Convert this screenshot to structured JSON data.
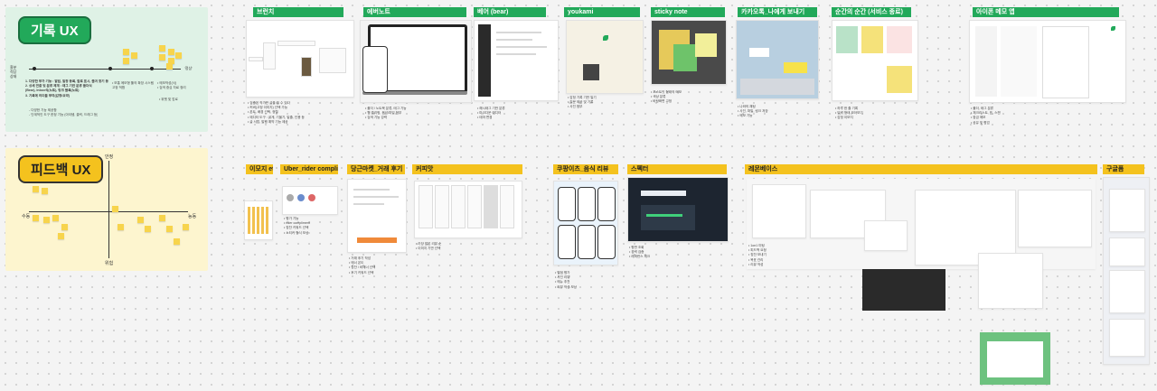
{
  "sections": {
    "record": {
      "title": "기록 UX",
      "bg": "#dff2e6"
    },
    "feedback": {
      "title": "피드백 UX",
      "bg": "#fdf5cf"
    }
  },
  "record_map": {
    "axis_left": "흥분\n적당\n상태",
    "axis_right": "'정상'",
    "points": [
      "1. 다양한 부가 기능 : 알림, 일정 등록, 할로 표시, 즐겨 찾기 등",
      "2. 상세 연결 및 분류 체계 : 태그 기반 분류 폴더식",
      "(Bear), Inbox식(노트), 링크 블록(노트)",
      "3. 기록에 의미를 부여(감정/요약)"
    ],
    "sub_notes": [
      "- 다양한 기능 제공함",
      "- 단계적인 도구 한정 기능 (아이템, 클릭, 드래그 등)"
    ],
    "mid_notes": [
      "• 보통 메모형 툴의 확장 시스템",
      "  고정 적합"
    ],
    "right_notes": [
      "• 메모작성(서)",
      "• 검색 중심 자료 정리"
    ],
    "far_note": "• 위젯 및 업로"
  },
  "feedback_map": {
    "top": "안정",
    "bottom": "위험",
    "left": "수동",
    "right": "능동"
  },
  "top_apps": [
    {
      "name": "브런치",
      "notes": [
        "• 검증된 작가만 글을 쓸 수 있다",
        "• 커버(고정 이미지) 선택 가능",
        "• 폰트, 배경 선택, 정렬",
        "• 에디터 도구 : 굵게, 기울기, 밑줄, 인용 등",
        "• 글 서랍, 발행 예약 기능 제공"
      ]
    },
    {
      "name": "에버노트",
      "notes": [
        "• 폴더 / 노트북 분류, 태그 기능",
        "• 웹 클리핑, 음성/파일 첨부",
        "• 검색 기능 강력"
      ]
    },
    {
      "name": "베어 (bear)",
      "notes": [
        "• 해시태그 기반 분류",
        "• 마크다운 에디터",
        "• 테마 변경"
      ]
    },
    {
      "name": "youkami",
      "notes": [
        "• 감정 기록 기반 일기",
        "• 질문 제공 및 기록",
        "• 사진 첨부"
      ]
    },
    {
      "name": "sticky note",
      "notes": [
        "• 포스트잇 형태의 메모",
        "• 색상 분류",
        "• 바탕화면 고정"
      ]
    },
    {
      "name": "카카오톡_나에게 보내기",
      "notes": [
        "• 나와의 채팅",
        "• 사진, 파일, 링크 저장",
        "• 메모 기능"
      ]
    },
    {
      "name": "순간의 순간 (서비스 종료)",
      "notes": [
        "• 하루 한 줄 기록",
        "• 달력 형태 모아보기",
        "• 감정 이모지"
      ]
    },
    {
      "name": "아이폰 메모 앱",
      "notes": [
        "• 폴더, 태그 분류",
        "• 체크리스트, 표, 스캔",
        "• 잠금 메모",
        "• 공유 및 협업"
      ]
    }
  ],
  "bottom_apps": [
    {
      "name": "이모지 etc."
    },
    {
      "name": "Uber_rider compliment",
      "notes": [
        "• 평가 기능",
        "• rider compliment",
        "• 칭찬 키워드 선택",
        "• 스티커 형식 보상"
      ]
    },
    {
      "name": "당근마켓_거래 후기",
      "notes": [
        "• 거래 후기 작성",
        "• 매너 온도",
        "• 칭찬 / 비매너 선택",
        "• 후기 키워드 선택"
      ]
    },
    {
      "name": "커피맛",
      "notes": [
        "• 가장 많은 리뷰 순",
        "• 이미지 기반 선택"
      ]
    },
    {
      "name": "쿠팡이츠_음식 리뷰",
      "notes": [
        "• 별점 평가",
        "• 사진 리뷰",
        "• 메뉴 추천",
        "• 리뷰 작성 보상"
      ]
    },
    {
      "name": "스펙터",
      "notes": [
        "• 평판 조회",
        "• 경력 검증",
        "• 레퍼런스 체크"
      ]
    },
    {
      "name": "레몬베이스",
      "notes": [
        "• 1on1 미팅",
        "• 피드백 요청",
        "• 칭찬 보내기",
        "• 목표 관리",
        "• 리뷰 작성"
      ]
    },
    {
      "name": "구글폼"
    }
  ],
  "colors": {
    "green": "#22a95a",
    "yellow": "#f4c21e",
    "sticky": "#f7d44c"
  }
}
